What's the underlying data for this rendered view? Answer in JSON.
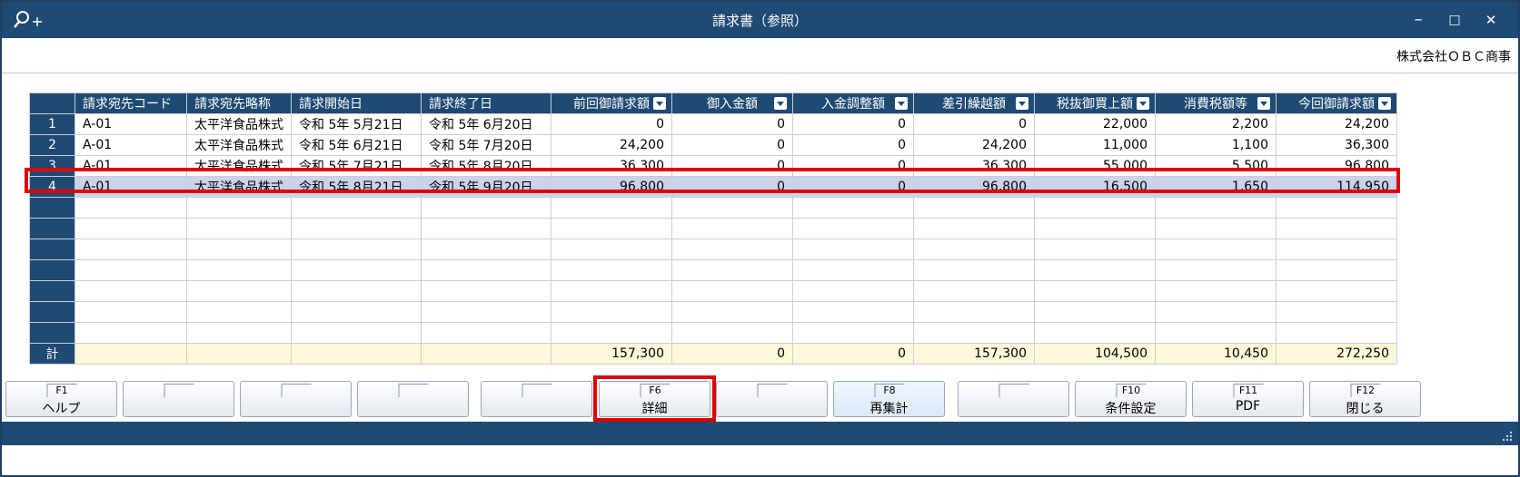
{
  "window": {
    "title": "請求書（参照）",
    "minimize": "–",
    "maximize": "□",
    "close": "✕"
  },
  "company": "株式会社ＯＢＣ商事",
  "grid": {
    "headers": [
      "請求宛先コード",
      "請求宛先略称",
      "請求開始日",
      "請求終了日",
      "前回御請求額",
      "御入金額",
      "入金調整額",
      "差引繰越額",
      "税抜御買上額",
      "消費税額等",
      "今回御請求額"
    ],
    "rows": [
      {
        "no": "1",
        "code": "A-01",
        "name": "太平洋食品株式",
        "start": "令和  5年  5月21日",
        "end": "令和  5年  6月20日",
        "prev": "0",
        "paid": "0",
        "adj": "0",
        "carry": "0",
        "sales": "22,000",
        "tax": "2,200",
        "total": "24,200"
      },
      {
        "no": "2",
        "code": "A-01",
        "name": "太平洋食品株式",
        "start": "令和  5年  6月21日",
        "end": "令和  5年  7月20日",
        "prev": "24,200",
        "paid": "0",
        "adj": "0",
        "carry": "24,200",
        "sales": "11,000",
        "tax": "1,100",
        "total": "36,300"
      },
      {
        "no": "3",
        "code": "A-01",
        "name": "太平洋食品株式",
        "start": "令和  5年  7月21日",
        "end": "令和  5年  8月20日",
        "prev": "36,300",
        "paid": "0",
        "adj": "0",
        "carry": "36,300",
        "sales": "55,000",
        "tax": "5,500",
        "total": "96,800"
      },
      {
        "no": "4",
        "code": "A-01",
        "name": "太平洋食品株式",
        "start": "令和  5年  8月21日",
        "end": "令和  5年  9月20日",
        "prev": "96,800",
        "paid": "0",
        "adj": "0",
        "carry": "96,800",
        "sales": "16,500",
        "tax": "1,650",
        "total": "114,950"
      }
    ],
    "totals": {
      "label": "計",
      "prev": "157,300",
      "paid": "0",
      "adj": "0",
      "carry": "157,300",
      "sales": "104,500",
      "tax": "10,450",
      "total": "272,250"
    }
  },
  "fkeys": [
    {
      "key": "F1",
      "label": "ヘルプ"
    },
    {
      "key": "",
      "label": ""
    },
    {
      "key": "",
      "label": ""
    },
    {
      "key": "",
      "label": ""
    },
    {
      "key": "",
      "label": ""
    },
    {
      "key": "F6",
      "label": "詳細"
    },
    {
      "key": "",
      "label": ""
    },
    {
      "key": "F8",
      "label": "再集計"
    },
    {
      "key": "",
      "label": ""
    },
    {
      "key": "F10",
      "label": "条件設定"
    },
    {
      "key": "F11",
      "label": "PDF"
    },
    {
      "key": "F12",
      "label": "閉じる"
    }
  ]
}
